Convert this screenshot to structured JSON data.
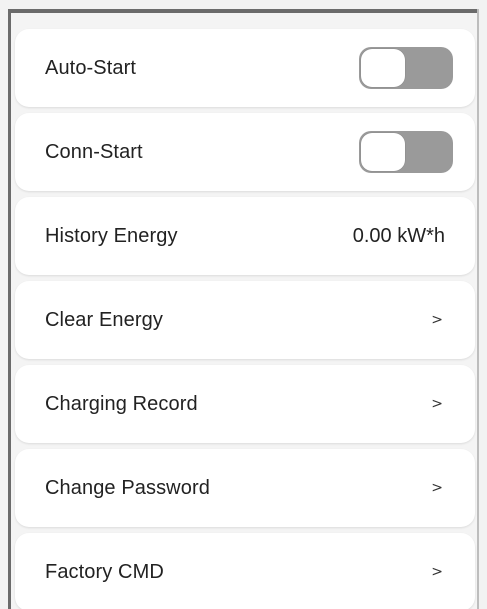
{
  "settings": {
    "items": [
      {
        "label": "Auto-Start",
        "control": "toggle",
        "on": false,
        "icon": "toggle-switch-icon"
      },
      {
        "label": "Conn-Start",
        "control": "toggle",
        "on": false,
        "icon": "toggle-switch-icon"
      },
      {
        "label": "History Energy",
        "control": "value",
        "value": "0.00 kW*h"
      },
      {
        "label": "Clear Energy",
        "control": "chevron",
        "chevron": ">",
        "icon": "chevron-right-icon"
      },
      {
        "label": "Charging Record",
        "control": "chevron",
        "chevron": ">",
        "icon": "chevron-right-icon"
      },
      {
        "label": "Change Password",
        "control": "chevron",
        "chevron": ">",
        "icon": "chevron-right-icon"
      },
      {
        "label": "Factory CMD",
        "control": "chevron",
        "chevron": ">",
        "icon": "chevron-right-icon"
      }
    ]
  },
  "colors": {
    "toggle_off_track": "#9a9a9a",
    "row_background": "#ffffff",
    "page_background": "#f4f4f4",
    "text": "#222222"
  }
}
